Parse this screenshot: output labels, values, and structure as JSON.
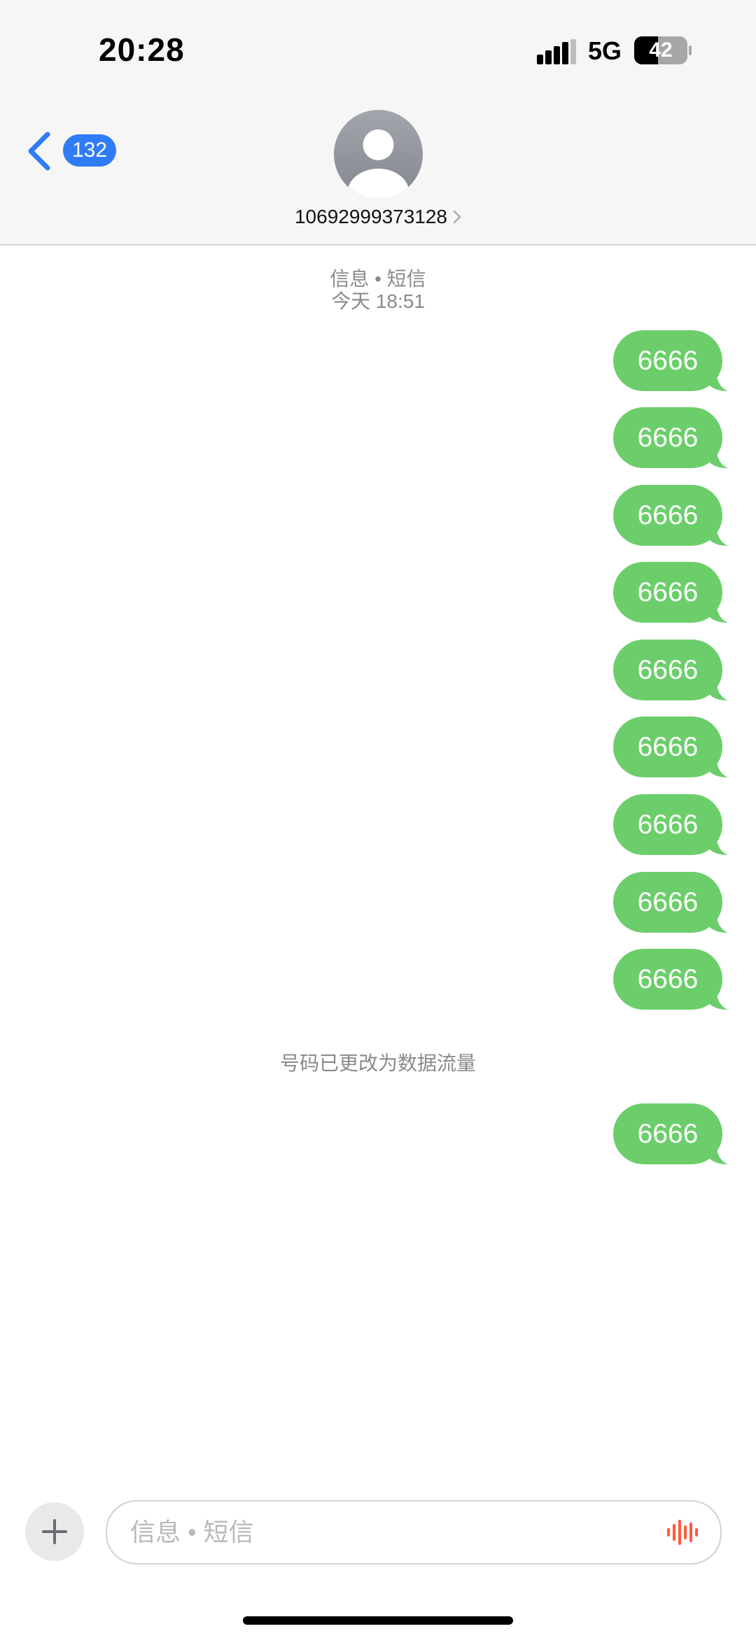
{
  "status_bar": {
    "time": "20:28",
    "network": "5G",
    "battery": "42"
  },
  "header": {
    "back_badge": "132",
    "contact": "10692999373128"
  },
  "conversation": {
    "service_label": "信息 • 短信",
    "timestamp": "今天 18:51",
    "notice": "号码已更改为数据流量",
    "messages": [
      "6666",
      "6666",
      "6666",
      "6666",
      "6666",
      "6666",
      "6666",
      "6666",
      "6666",
      "6666"
    ]
  },
  "composer": {
    "placeholder": "信息 • 短信"
  },
  "colors": {
    "bubble": "#6cce6b",
    "accent": "#2f7cf6",
    "mic": "#ff5a3c"
  }
}
